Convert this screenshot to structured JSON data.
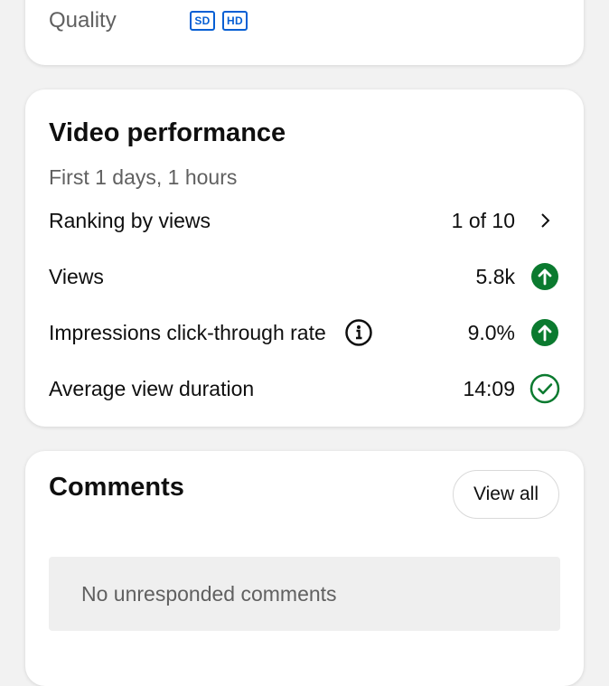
{
  "quality_card": {
    "label": "Quality",
    "badges": [
      "SD",
      "HD"
    ]
  },
  "performance": {
    "title": "Video performance",
    "subtitle": "First 1 days, 1 hours",
    "ranking": {
      "label": "Ranking by views",
      "value": "1 of 10",
      "icon": "chevron-right-icon"
    },
    "views": {
      "label": "Views",
      "value": "5.8k",
      "icon": "arrow-up-circle-icon"
    },
    "ctr": {
      "label": "Impressions click-through rate",
      "value": "9.0%",
      "icon": "arrow-up-circle-icon",
      "info_icon": "info-icon"
    },
    "avg_duration": {
      "label": "Average view duration",
      "value": "14:09",
      "icon": "check-circle-icon"
    }
  },
  "comments": {
    "title": "Comments",
    "view_all_label": "View all",
    "empty_message": "No unresponded comments"
  },
  "colors": {
    "brand_blue": "#065fd4",
    "positive_green": "#0b7a2f",
    "secondary_text": "#606060",
    "card_bg": "#ffffff",
    "page_bg": "#f2f2f2"
  }
}
